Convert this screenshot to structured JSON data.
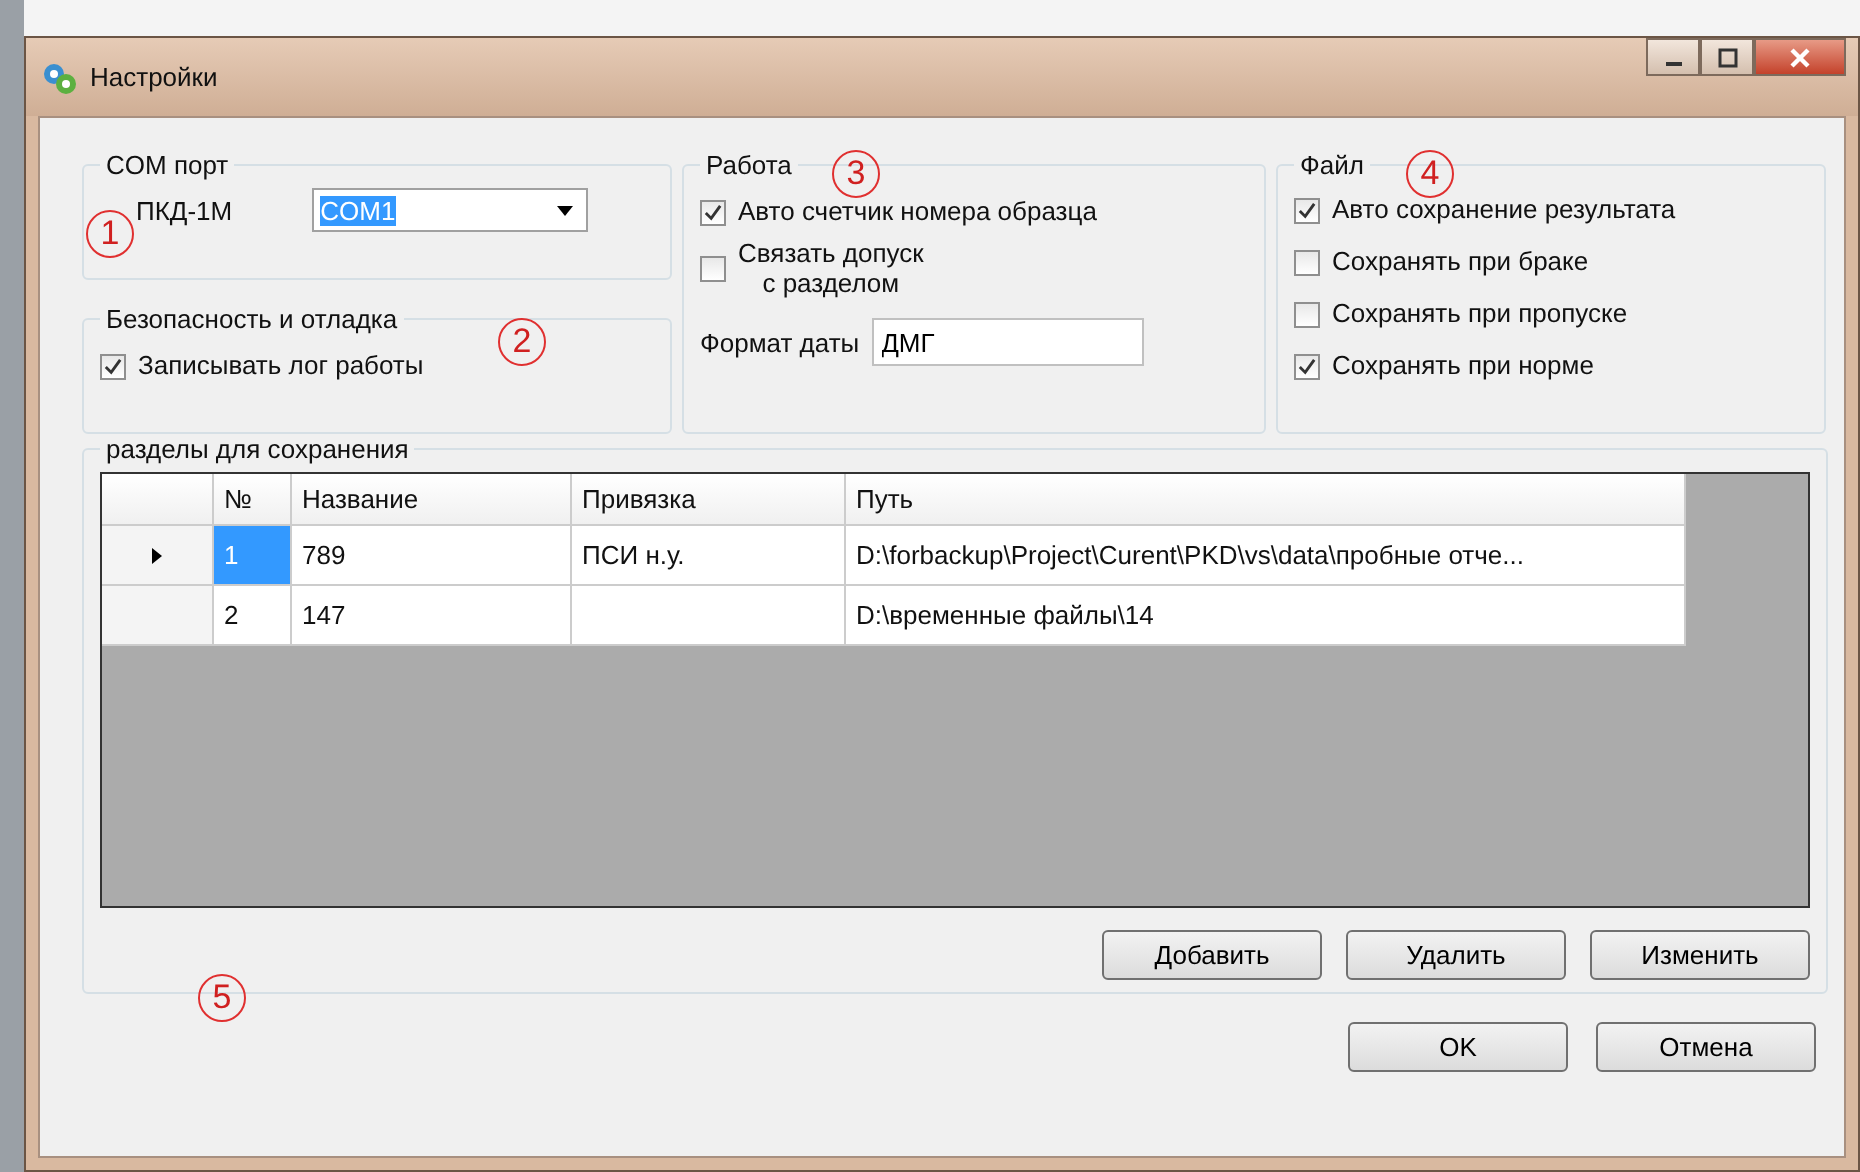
{
  "window": {
    "title": "Настройки"
  },
  "com_port": {
    "title": "COM порт",
    "label": "ПКД-1М",
    "value": "COM1"
  },
  "debug": {
    "title": "Безопасность и отладка",
    "options": [
      {
        "label": "Записывать лог работы",
        "checked": true
      }
    ]
  },
  "work": {
    "title": "Работа",
    "options": [
      {
        "label": "Авто счетчик номера образца",
        "checked": true
      },
      {
        "label": "Связать допуск\nс разделом",
        "checked": false
      }
    ],
    "date_label": "Формат даты",
    "date_value": "ДМГ"
  },
  "file": {
    "title": "Файл",
    "options": [
      {
        "label": "Авто сохранение результата",
        "checked": true
      },
      {
        "label": "Сохранять при браке",
        "checked": false
      },
      {
        "label": "Сохранять при пропуске",
        "checked": false
      },
      {
        "label": "Сохранять при норме",
        "checked": true
      }
    ]
  },
  "sections": {
    "title": "разделы для сохранения",
    "columns": [
      "№",
      "Название",
      "Привязка",
      "Путь"
    ],
    "rows": [
      {
        "number": "1",
        "name": "789",
        "binding": "ПСИ н.у.",
        "path": "D:\\forbackup\\Project\\Curent\\PKD\\vs\\data\\пробные отче...",
        "selected": true
      },
      {
        "number": "2",
        "name": "147",
        "path": "D:\\временные файлы\\14",
        "selected": false
      }
    ],
    "buttons": [
      "Добавить",
      "Удалить",
      "Изменить"
    ]
  },
  "buttons": [
    "OK",
    "Отмена"
  ],
  "annotations": [
    "1",
    "2",
    "3",
    "4",
    "5"
  ]
}
